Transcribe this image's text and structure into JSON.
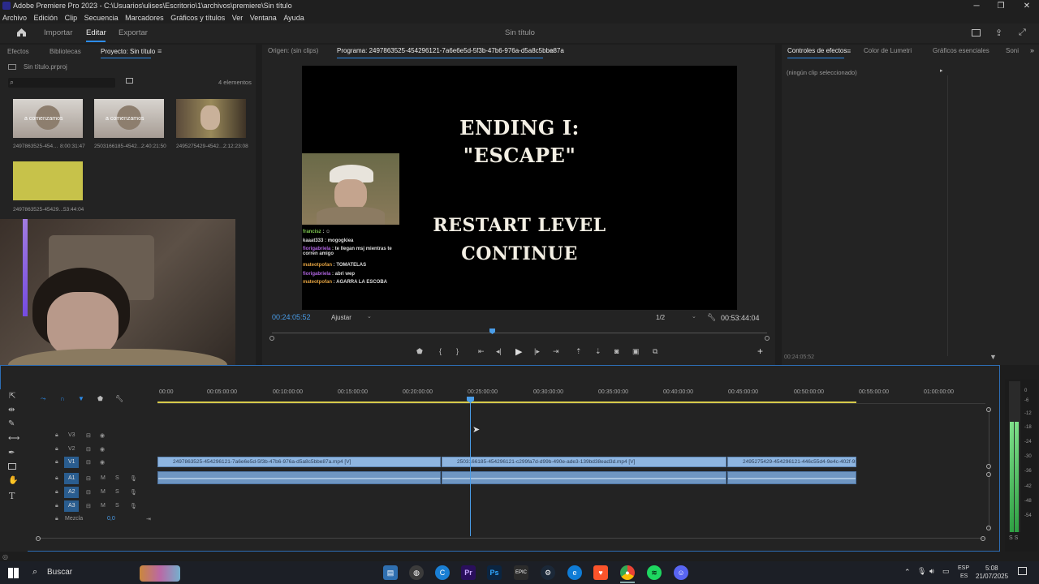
{
  "window": {
    "title": "Adobe Premiere Pro 2023 - C:\\Usuarios\\ulises\\Escritorio\\1\\archivos\\premiere\\Sin título",
    "minimize": "─",
    "maximize": "❐",
    "close": "✕"
  },
  "menu": [
    "Archivo",
    "Edición",
    "Clip",
    "Secuencia",
    "Marcadores",
    "Gráficos y títulos",
    "Ver",
    "Ventana",
    "Ayuda"
  ],
  "workspace": {
    "tabs": [
      "Importar",
      "Editar",
      "Exportar"
    ],
    "active": "Editar",
    "document": "Sin título"
  },
  "project_panel": {
    "tabs": [
      "Efectos",
      "Bibliotecas",
      "Proyecto: Sin título"
    ],
    "file": "Sin título.prproj",
    "count": "4 elementos",
    "items": [
      {
        "name": "2497863525-454…",
        "duration": "8:00:31:47",
        "overlay": "a comenzamos"
      },
      {
        "name": "2503166185-4542…",
        "duration": "2:40:21:50",
        "overlay": "a comenzamos"
      },
      {
        "name": "2495275429-4542…",
        "duration": "2:12:23:08",
        "overlay": ""
      },
      {
        "name": "2497863525-45429…",
        "duration": "53:44:04",
        "overlay": ""
      }
    ]
  },
  "program_panel": {
    "source_tab": "Origen: (sin clips)",
    "program_tab": "Programa: 2497863525-454296121-7a6e6e5d-5f3b-47b6-976a-d5a8c5bbe87a",
    "timecode": "00:24:05:52",
    "fit": "Ajustar",
    "quality": "1/2",
    "duration": "00:53:44:04",
    "frame": {
      "ending_line1": "ENDING I:",
      "ending_line2": "\"ESCAPE\"",
      "option1": "RESTART LEVEL",
      "option2": "CONTINUE",
      "chat": [
        {
          "user": "francisz",
          "msg": ": ☺",
          "color": "#7ec850"
        },
        {
          "user": "kaaat333",
          "msg": ": mogogkiea",
          "color": "#d9d9d9"
        },
        {
          "user": "fiorigabriela",
          "msg": ": te llegan msj mientras te corren amigo",
          "color": "#b065e0"
        },
        {
          "user": "mateotpofan",
          "msg": ": TOMATELAS",
          "color": "#e0a040"
        },
        {
          "user": "fiorigabriela",
          "msg": ": abri wep",
          "color": "#b065e0"
        },
        {
          "user": "mateotpofan",
          "msg": ": AGARRA LA ESCOBA",
          "color": "#e0a040"
        }
      ]
    }
  },
  "effects_panel": {
    "tabs": [
      "Controles de efectos",
      "Color de Lumetri",
      "Gráficos esenciales",
      "Soni"
    ],
    "message": "(ningún clip seleccionado)",
    "timecode": "00:24:05:52"
  },
  "timeline": {
    "ruler": [
      "00:00",
      "00:05:00:00",
      "00:10:00:00",
      "00:15:00:00",
      "00:20:00:00",
      "00:25:00:00",
      "00:30:00:00",
      "00:35:00:00",
      "00:40:00:00",
      "00:45:00:00",
      "00:50:00:00",
      "00:55:00:00",
      "01:00:00:00"
    ],
    "tracks": [
      {
        "name": "V3",
        "type": "video"
      },
      {
        "name": "V2",
        "type": "video"
      },
      {
        "name": "V1",
        "type": "video"
      },
      {
        "name": "A1",
        "type": "audio"
      },
      {
        "name": "A2",
        "type": "audio"
      },
      {
        "name": "A3",
        "type": "audio"
      }
    ],
    "mix_label": "Mezcla",
    "mix_value": "0,0",
    "clips": [
      "2497863525-454296121-7a6e6e5d-5f3b-47b6-976a-d5a8c5bbe87a.mp4 [V]",
      "2503166185-454296121-c299fa7d-d99b-490e-ade3-139bd38ead3d.mp4 [V]",
      "2495275429-454296121-446c55d4-9e4c-402f-985b"
    ],
    "meter_scale": [
      "0",
      "-6",
      "-12",
      "-18",
      "-24",
      "-30",
      "-36",
      "-42",
      "-48",
      "-54"
    ],
    "meter_labels": "S S"
  },
  "taskbar": {
    "search": "Buscar",
    "lang1": "ESP",
    "lang2": "ES",
    "time": "5:08",
    "date": "21/07/2025",
    "apps": [
      "files-icon",
      "obs-icon",
      "ccleaner-icon",
      "premiere-icon",
      "photoshop-icon",
      "epic-icon",
      "steam-icon",
      "edge-icon",
      "brave-icon",
      "chrome-icon",
      "spotify-icon",
      "discord-icon"
    ]
  }
}
